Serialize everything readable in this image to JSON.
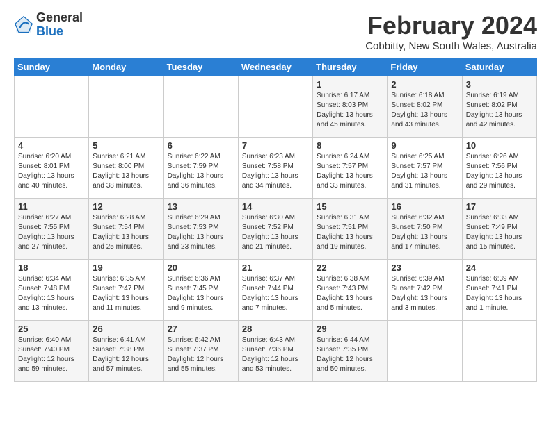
{
  "header": {
    "logo_general": "General",
    "logo_blue": "Blue",
    "month_year": "February 2024",
    "location": "Cobbitty, New South Wales, Australia"
  },
  "weekdays": [
    "Sunday",
    "Monday",
    "Tuesday",
    "Wednesday",
    "Thursday",
    "Friday",
    "Saturday"
  ],
  "weeks": [
    [
      {
        "day": "",
        "info": ""
      },
      {
        "day": "",
        "info": ""
      },
      {
        "day": "",
        "info": ""
      },
      {
        "day": "",
        "info": ""
      },
      {
        "day": "1",
        "info": "Sunrise: 6:17 AM\nSunset: 8:03 PM\nDaylight: 13 hours\nand 45 minutes."
      },
      {
        "day": "2",
        "info": "Sunrise: 6:18 AM\nSunset: 8:02 PM\nDaylight: 13 hours\nand 43 minutes."
      },
      {
        "day": "3",
        "info": "Sunrise: 6:19 AM\nSunset: 8:02 PM\nDaylight: 13 hours\nand 42 minutes."
      }
    ],
    [
      {
        "day": "4",
        "info": "Sunrise: 6:20 AM\nSunset: 8:01 PM\nDaylight: 13 hours\nand 40 minutes."
      },
      {
        "day": "5",
        "info": "Sunrise: 6:21 AM\nSunset: 8:00 PM\nDaylight: 13 hours\nand 38 minutes."
      },
      {
        "day": "6",
        "info": "Sunrise: 6:22 AM\nSunset: 7:59 PM\nDaylight: 13 hours\nand 36 minutes."
      },
      {
        "day": "7",
        "info": "Sunrise: 6:23 AM\nSunset: 7:58 PM\nDaylight: 13 hours\nand 34 minutes."
      },
      {
        "day": "8",
        "info": "Sunrise: 6:24 AM\nSunset: 7:57 PM\nDaylight: 13 hours\nand 33 minutes."
      },
      {
        "day": "9",
        "info": "Sunrise: 6:25 AM\nSunset: 7:57 PM\nDaylight: 13 hours\nand 31 minutes."
      },
      {
        "day": "10",
        "info": "Sunrise: 6:26 AM\nSunset: 7:56 PM\nDaylight: 13 hours\nand 29 minutes."
      }
    ],
    [
      {
        "day": "11",
        "info": "Sunrise: 6:27 AM\nSunset: 7:55 PM\nDaylight: 13 hours\nand 27 minutes."
      },
      {
        "day": "12",
        "info": "Sunrise: 6:28 AM\nSunset: 7:54 PM\nDaylight: 13 hours\nand 25 minutes."
      },
      {
        "day": "13",
        "info": "Sunrise: 6:29 AM\nSunset: 7:53 PM\nDaylight: 13 hours\nand 23 minutes."
      },
      {
        "day": "14",
        "info": "Sunrise: 6:30 AM\nSunset: 7:52 PM\nDaylight: 13 hours\nand 21 minutes."
      },
      {
        "day": "15",
        "info": "Sunrise: 6:31 AM\nSunset: 7:51 PM\nDaylight: 13 hours\nand 19 minutes."
      },
      {
        "day": "16",
        "info": "Sunrise: 6:32 AM\nSunset: 7:50 PM\nDaylight: 13 hours\nand 17 minutes."
      },
      {
        "day": "17",
        "info": "Sunrise: 6:33 AM\nSunset: 7:49 PM\nDaylight: 13 hours\nand 15 minutes."
      }
    ],
    [
      {
        "day": "18",
        "info": "Sunrise: 6:34 AM\nSunset: 7:48 PM\nDaylight: 13 hours\nand 13 minutes."
      },
      {
        "day": "19",
        "info": "Sunrise: 6:35 AM\nSunset: 7:47 PM\nDaylight: 13 hours\nand 11 minutes."
      },
      {
        "day": "20",
        "info": "Sunrise: 6:36 AM\nSunset: 7:45 PM\nDaylight: 13 hours\nand 9 minutes."
      },
      {
        "day": "21",
        "info": "Sunrise: 6:37 AM\nSunset: 7:44 PM\nDaylight: 13 hours\nand 7 minutes."
      },
      {
        "day": "22",
        "info": "Sunrise: 6:38 AM\nSunset: 7:43 PM\nDaylight: 13 hours\nand 5 minutes."
      },
      {
        "day": "23",
        "info": "Sunrise: 6:39 AM\nSunset: 7:42 PM\nDaylight: 13 hours\nand 3 minutes."
      },
      {
        "day": "24",
        "info": "Sunrise: 6:39 AM\nSunset: 7:41 PM\nDaylight: 13 hours\nand 1 minute."
      }
    ],
    [
      {
        "day": "25",
        "info": "Sunrise: 6:40 AM\nSunset: 7:40 PM\nDaylight: 12 hours\nand 59 minutes."
      },
      {
        "day": "26",
        "info": "Sunrise: 6:41 AM\nSunset: 7:38 PM\nDaylight: 12 hours\nand 57 minutes."
      },
      {
        "day": "27",
        "info": "Sunrise: 6:42 AM\nSunset: 7:37 PM\nDaylight: 12 hours\nand 55 minutes."
      },
      {
        "day": "28",
        "info": "Sunrise: 6:43 AM\nSunset: 7:36 PM\nDaylight: 12 hours\nand 53 minutes."
      },
      {
        "day": "29",
        "info": "Sunrise: 6:44 AM\nSunset: 7:35 PM\nDaylight: 12 hours\nand 50 minutes."
      },
      {
        "day": "",
        "info": ""
      },
      {
        "day": "",
        "info": ""
      }
    ]
  ]
}
